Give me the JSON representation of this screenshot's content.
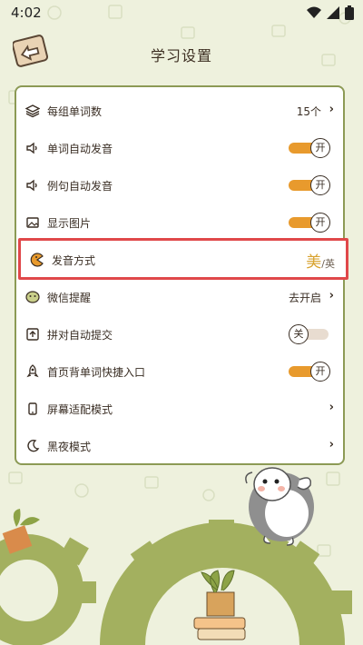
{
  "status": {
    "time": "4:02"
  },
  "header": {
    "title": "学习设置"
  },
  "settings": [
    {
      "label": "每组单词数",
      "value": "15个",
      "icon": "layers-icon"
    },
    {
      "label": "单词自动发音",
      "toggle": "开",
      "icon": "speaker-icon"
    },
    {
      "label": "例句自动发音",
      "toggle": "开",
      "icon": "speaker-icon"
    },
    {
      "label": "显示图片",
      "toggle": "开",
      "icon": "image-icon"
    },
    {
      "label": "发音方式",
      "voice_primary": "美",
      "voice_secondary": "/英",
      "icon": "pacman-icon"
    },
    {
      "label": "微信提醒",
      "value": "去开启",
      "icon": "wechat-icon"
    },
    {
      "label": "拼对自动提交",
      "toggle": "关",
      "icon": "upload-icon"
    },
    {
      "label": "首页背单词快捷入口",
      "toggle": "开",
      "icon": "rocket-icon"
    },
    {
      "label": "屏幕适配模式",
      "icon": "phone-icon"
    },
    {
      "label": "黑夜模式",
      "icon": "moon-icon"
    }
  ],
  "colors": {
    "accent": "#e89a2d",
    "border": "#8c9a55",
    "highlight": "#e0484a",
    "background": "#eef1dd"
  }
}
